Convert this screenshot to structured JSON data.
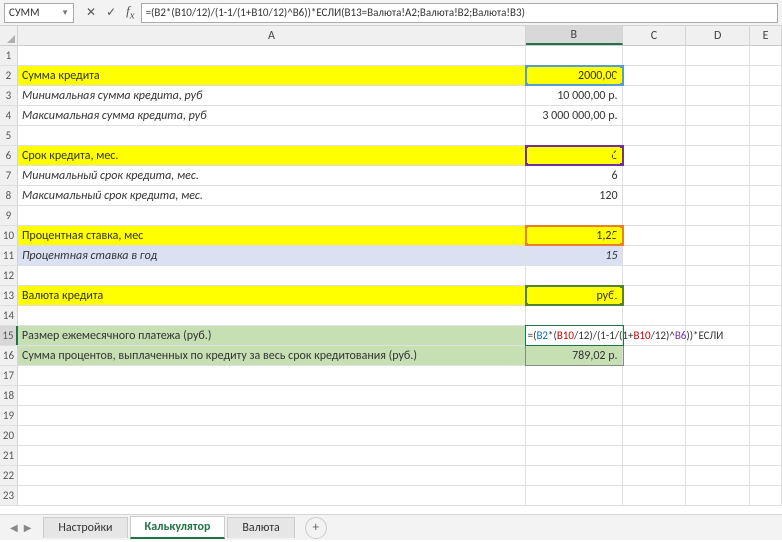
{
  "nameBox": "СУММ",
  "formula": "=(B2*(B10/12)/(1-1/(1+B10/12)^B6))*ЕСЛИ(B13=Валюта!A2;Валюта!B2;Валюта!B3)",
  "colHeaders": [
    "A",
    "B",
    "C",
    "D",
    "E"
  ],
  "rows": {
    "2": {
      "a": "Сумма кредита",
      "b": "2000,00"
    },
    "3": {
      "a": "Минимальная сумма кредита, руб",
      "b": "10 000,00 р."
    },
    "4": {
      "a": "Максимальная сумма кредита, руб",
      "b": "3 000 000,00 р."
    },
    "6": {
      "a": "Срок кредита, мес.",
      "b": "6"
    },
    "7": {
      "a": "Минимальный срок кредита, мес.",
      "b": "6"
    },
    "8": {
      "a": "Максимальный срок кредита, мес.",
      "b": "120"
    },
    "10": {
      "a": "Процентная ставка, мес",
      "b": "1,25"
    },
    "11": {
      "a": "Процентная ставка в год",
      "b": "15"
    },
    "13": {
      "a": "Валюта кредита",
      "b": "руб."
    },
    "15": {
      "a": "Размер ежемесячного платежа (руб.)"
    },
    "16": {
      "a": "Сумма процентов, выплаченных по кредиту за весь срок кредитования (руб.)",
      "b": "789,02 р."
    }
  },
  "editCell": {
    "p1": "=(",
    "b2": "B2",
    "p2": "*(",
    "b10a": "B10",
    "p3": "/12)/",
    "p4": "(1-1/(1+",
    "b10b": "B10",
    "p5": "/12)^",
    "b6": "B6",
    "p6": "))*ЕСЛИ"
  },
  "tabs": {
    "t1": "Настройки",
    "t2": "Калькулятор",
    "t3": "Валюта"
  }
}
